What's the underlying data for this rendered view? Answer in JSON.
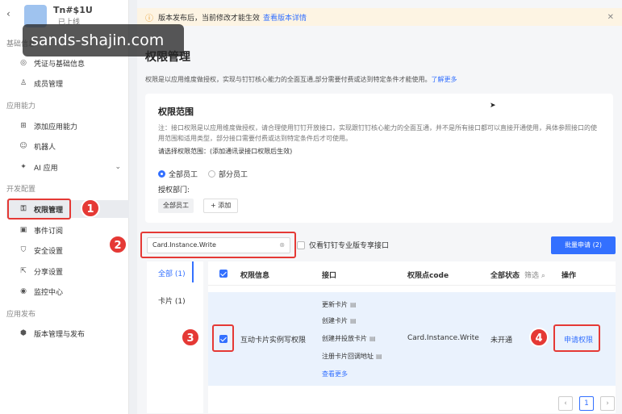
{
  "app": {
    "name": "Tn#$1U",
    "status": "已上线"
  },
  "watermark": "sands-shajin.com",
  "nav": {
    "section_basic": "基础信息",
    "item_credentials": "凭证与基础信息",
    "item_members": "成员管理",
    "section_capability": "应用能力",
    "item_add_capability": "添加应用能力",
    "item_bot": "机器人",
    "item_ai_app": "AI 应用",
    "section_dev": "开发配置",
    "item_permissions": "权限管理",
    "item_events": "事件订阅",
    "item_security": "安全设置",
    "item_share": "分享设置",
    "item_monitor": "监控中心",
    "section_release": "应用发布",
    "item_versions": "版本管理与发布"
  },
  "notice": {
    "text": "版本发布后，当前修改才能生效",
    "link": "查看版本详情"
  },
  "page": {
    "title": "权限管理",
    "desc": "权限是以应用维度做授权，实现与钉钉核心能力的全面互通,部分需要付费或达到特定条件才能使用。",
    "desc_link": "了解更多"
  },
  "scope": {
    "title": "权限范围",
    "note": "注：接口权限是以应用维度做授权，请合理使用钉钉开放接口，实现跟钉钉核心能力的全面互通，并不是所有接口都可以直接开通使用，具体参照接口的使用范围和适用类型，部分接口需要付费或达到特定条件后才可使用。",
    "select_label": "请选择权限范围：(添加通讯录接口权限后生效)",
    "radio_all": "全部员工",
    "radio_part": "部分员工",
    "dept_label": "授权部门:",
    "chip": "全部员工",
    "add": "+ 添加"
  },
  "toolbar": {
    "search_value": "Card.Instance.Write",
    "pro_only": "仅看钉钉专业版专享接口",
    "batch": "批量申请 (2)"
  },
  "filters": {
    "all": "全部 (1)",
    "card": "卡片 (1)"
  },
  "table": {
    "headers": {
      "info": "权限信息",
      "api": "接口",
      "code": "权限点code",
      "status": "全部状态",
      "filter": "筛选",
      "action": "操作"
    },
    "row": {
      "name": "互动卡片实例写权限",
      "apis": [
        "更新卡片",
        "创建卡片",
        "创建并投放卡片",
        "注册卡片回调地址"
      ],
      "more": "查看更多",
      "code": "Card.Instance.Write",
      "status": "未开通",
      "action": "申请权限"
    }
  },
  "callouts": [
    "1",
    "2",
    "3",
    "4"
  ],
  "pager": {
    "prev": "‹",
    "current": "1",
    "next": "›"
  }
}
